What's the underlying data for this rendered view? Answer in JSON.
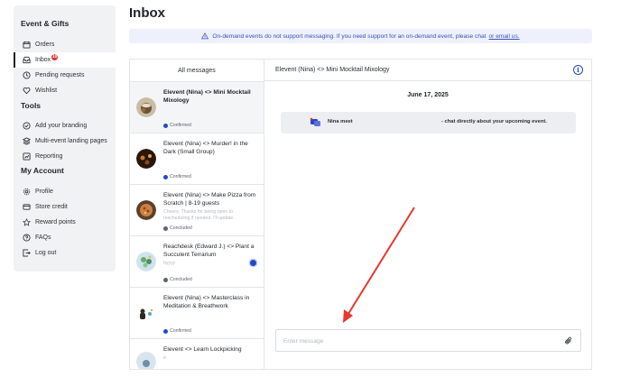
{
  "sidebar": {
    "sections": [
      {
        "title": "Event & Gifts"
      },
      {
        "title": "Tools"
      },
      {
        "title": "My Account"
      }
    ],
    "items": [
      {
        "label": "Orders",
        "icon": "calendar-icon"
      },
      {
        "label": "Inbox",
        "icon": "inbox-icon",
        "badge": "10",
        "active": true
      },
      {
        "label": "Pending requests",
        "icon": "clock-icon"
      },
      {
        "label": "Wishlist",
        "icon": "heart-icon"
      },
      {
        "label": "Add your branding",
        "icon": "check-circle-icon"
      },
      {
        "label": "Multi-event landing pages",
        "icon": "layers-icon"
      },
      {
        "label": "Reporting",
        "icon": "chart-icon"
      },
      {
        "label": "Profile",
        "icon": "gear-icon"
      },
      {
        "label": "Store credit",
        "icon": "credit-card-icon"
      },
      {
        "label": "Reward points",
        "icon": "star-icon"
      },
      {
        "label": "FAQs",
        "icon": "question-icon"
      },
      {
        "label": "Log out",
        "icon": "logout-icon"
      }
    ]
  },
  "page_title": "Inbox",
  "notice": {
    "text": "On-demand events do not support messaging. If you need support for an on-demand event, please chat",
    "link_text": "or email us."
  },
  "messages": {
    "list_header": "All messages",
    "conversations": [
      {
        "title": "Elevent (Nina) <> Mini Mocktail Mixology",
        "preview": "",
        "status": "Confirmed",
        "status_color": "#2746c9",
        "selected": true
      },
      {
        "title": "Elevent (Nina) <> Murder! in the Dark (Small Group)",
        "preview": "",
        "status": "Confirmed",
        "status_color": "#2746c9"
      },
      {
        "title": "Elevent (Nina) <> Make Pizza from Scratch | 8-19 guests",
        "preview": "Cheers: Thanks for being open to rescheduling if needed. I'll update",
        "status": "Concluded",
        "status_color": "#5b6370"
      },
      {
        "title": "Reachdesk (Edward J.) <> Plant a Succulent Terrarium",
        "preview": "hyyyy",
        "status": "Concluded",
        "status_color": "#5b6370",
        "unread": true
      },
      {
        "title": "Elevent (Nina) <> Masterclass in Meditation & Breathwork",
        "preview": "",
        "status": "Confirmed",
        "status_color": "#2746c9"
      },
      {
        "title": "Elevent <> Learn Lockpicking",
        "preview": "e",
        "status": "",
        "status_color": "#5b6370"
      }
    ]
  },
  "chat": {
    "header_title": "Elevent (Nina) <> Mini Mocktail Mixology",
    "date": "June 17, 2025",
    "system_message": {
      "name": "Nina meet",
      "text": "- chat directly about your upcoming event."
    },
    "composer_placeholder": "Enter message"
  },
  "colors": {
    "accent": "#2746c9",
    "badge": "#e0322e",
    "annotation_arrow": "#e8372c"
  }
}
